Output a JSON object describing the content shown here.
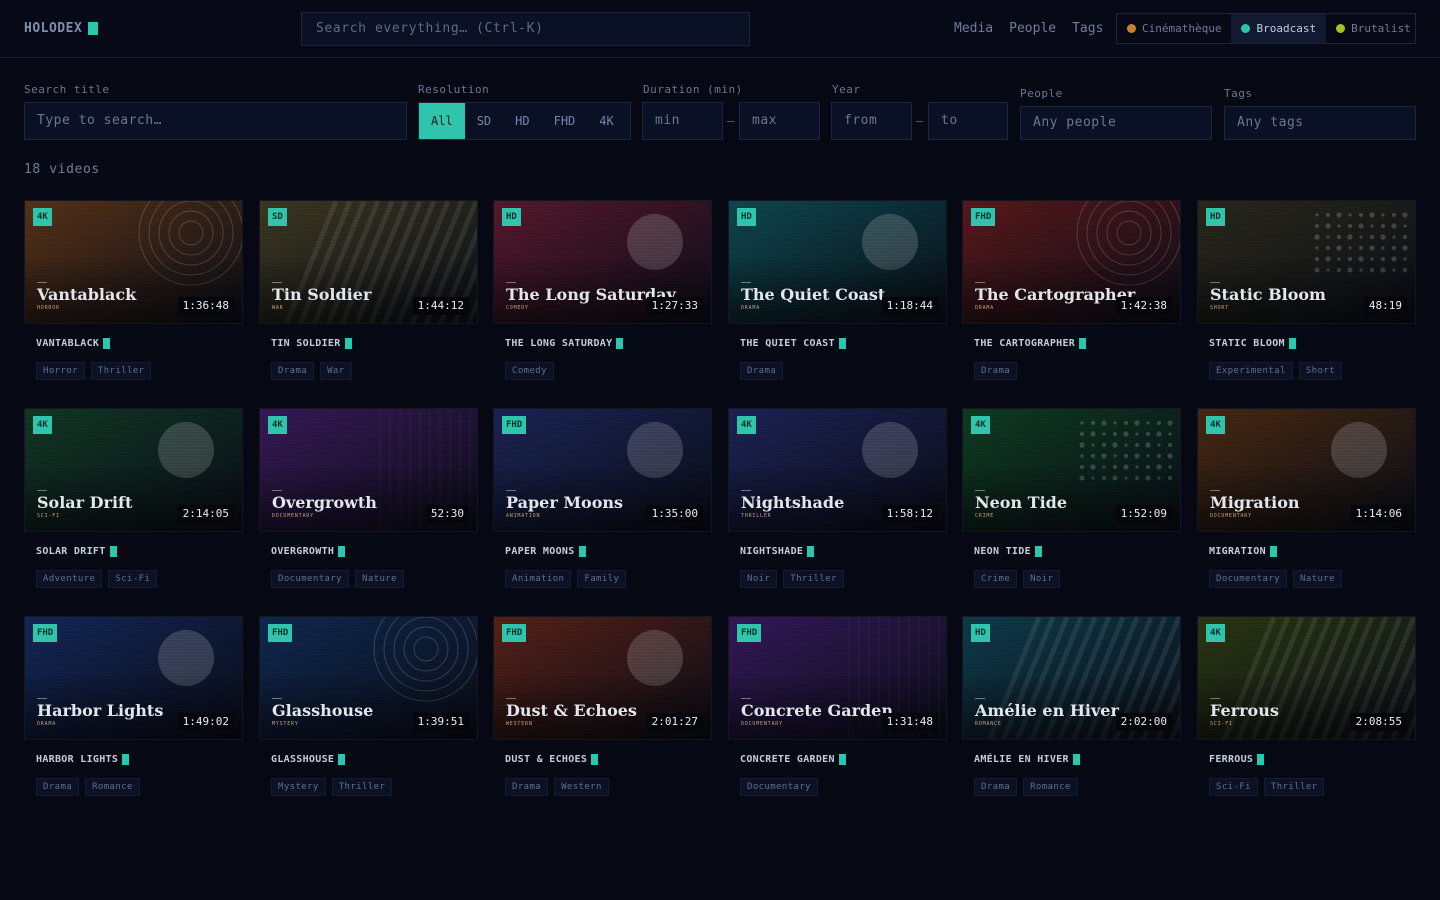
{
  "app": {
    "logo": "HOLODEX"
  },
  "search": {
    "placeholder": "Search everything…  (Ctrl-K)"
  },
  "nav": [
    "Media",
    "People",
    "Tags"
  ],
  "themes": [
    {
      "label": "Cinémathèque",
      "color": "#c9832a",
      "active": false
    },
    {
      "label": "Broadcast",
      "color": "#2fc5ad",
      "active": true
    },
    {
      "label": "Brutalist",
      "color": "#a2c22a",
      "active": false
    }
  ],
  "filters": {
    "title_label": "Search title",
    "title_placeholder": "Type to search…",
    "resolution_label": "Resolution",
    "resolutions": [
      "All",
      "SD",
      "HD",
      "FHD",
      "4K"
    ],
    "resolution_selected": "All",
    "duration_label": "Duration (min)",
    "duration_min": "min",
    "duration_max": "max",
    "year_label": "Year",
    "year_from": "from",
    "year_to": "to",
    "people_label": "People",
    "people_placeholder": "Any people",
    "tags_label": "Tags",
    "tags_placeholder": "Any tags",
    "range_sep": "–"
  },
  "results": {
    "count_text": "18 videos"
  },
  "videos": [
    {
      "title": "Vantablack",
      "upper": "VANTABLACK",
      "res": "4K",
      "duration": "1:36:48",
      "genre": "HORROR",
      "tags": [
        "Horror",
        "Thriller"
      ],
      "color": "#5a3418",
      "pattern": "rings"
    },
    {
      "title": "Tin Soldier",
      "upper": "TIN SOLDIER",
      "res": "SD",
      "duration": "1:44:12",
      "genre": "WAR",
      "tags": [
        "Drama",
        "War"
      ],
      "color": "#3e3a22",
      "pattern": "stripes"
    },
    {
      "title": "The Long Saturday",
      "upper": "THE LONG SATURDAY",
      "res": "HD",
      "duration": "1:27:33",
      "genre": "COMEDY",
      "tags": [
        "Comedy"
      ],
      "color": "#5a1a2e",
      "pattern": "circle"
    },
    {
      "title": "The Quiet Coast",
      "upper": "THE QUIET COAST",
      "res": "HD",
      "duration": "1:18:44",
      "genre": "DRAMA",
      "tags": [
        "Drama"
      ],
      "color": "#0f4a52",
      "pattern": "circle"
    },
    {
      "title": "The Cartographer",
      "upper": "THE CARTOGRAPHER",
      "res": "FHD",
      "duration": "1:42:38",
      "genre": "DRAMA",
      "tags": [
        "Drama"
      ],
      "color": "#5c1a1c",
      "pattern": "rings"
    },
    {
      "title": "Static Bloom",
      "upper": "STATIC BLOOM",
      "res": "HD",
      "duration": "48:19",
      "genre": "SHORT",
      "tags": [
        "Experimental",
        "Short"
      ],
      "color": "#2c2a1c",
      "pattern": "dots"
    },
    {
      "title": "Solar Drift",
      "upper": "SOLAR DRIFT",
      "res": "4K",
      "duration": "2:14:05",
      "genre": "SCI-FI",
      "tags": [
        "Adventure",
        "Sci-Fi"
      ],
      "color": "#123a26",
      "pattern": "circle"
    },
    {
      "title": "Overgrowth",
      "upper": "OVERGROWTH",
      "res": "4K",
      "duration": "52:30",
      "genre": "DOCUMENTARY",
      "tags": [
        "Documentary",
        "Nature"
      ],
      "color": "#3a1a5a",
      "pattern": "grid"
    },
    {
      "title": "Paper Moons",
      "upper": "PAPER MOONS",
      "res": "FHD",
      "duration": "1:35:00",
      "genre": "ANIMATION",
      "tags": [
        "Animation",
        "Family"
      ],
      "color": "#1c2658",
      "pattern": "circle"
    },
    {
      "title": "Nightshade",
      "upper": "NIGHTSHADE",
      "res": "4K",
      "duration": "1:58:12",
      "genre": "THRILLER",
      "tags": [
        "Noir",
        "Thriller"
      ],
      "color": "#1e2458",
      "pattern": "circle"
    },
    {
      "title": "Neon Tide",
      "upper": "NEON TIDE",
      "res": "4K",
      "duration": "1:52:09",
      "genre": "CRIME",
      "tags": [
        "Crime",
        "Noir"
      ],
      "color": "#0f3e22",
      "pattern": "dots"
    },
    {
      "title": "Migration",
      "upper": "MIGRATION",
      "res": "4K",
      "duration": "1:14:06",
      "genre": "DOCUMENTARY",
      "tags": [
        "Documentary",
        "Nature"
      ],
      "color": "#4a2a12",
      "pattern": "circle"
    },
    {
      "title": "Harbor Lights",
      "upper": "HARBOR LIGHTS",
      "res": "FHD",
      "duration": "1:49:02",
      "genre": "DRAMA",
      "tags": [
        "Drama",
        "Romance"
      ],
      "color": "#14285a",
      "pattern": "circle"
    },
    {
      "title": "Glasshouse",
      "upper": "GLASSHOUSE",
      "res": "FHD",
      "duration": "1:39:51",
      "genre": "MYSTERY",
      "tags": [
        "Mystery",
        "Thriller"
      ],
      "color": "#102a52",
      "pattern": "rings"
    },
    {
      "title": "Dust & Echoes",
      "upper": "DUST & ECHOES",
      "res": "FHD",
      "duration": "2:01:27",
      "genre": "WESTERN",
      "tags": [
        "Drama",
        "Western"
      ],
      "color": "#5a2218",
      "pattern": "circle"
    },
    {
      "title": "Concrete Garden",
      "upper": "CONCRETE GARDEN",
      "res": "FHD",
      "duration": "1:31:48",
      "genre": "DOCUMENTARY",
      "tags": [
        "Documentary"
      ],
      "color": "#361a5c",
      "pattern": "grid"
    },
    {
      "title": "Amélie en Hiver",
      "upper": "AMÉLIE EN HIVER",
      "res": "HD",
      "duration": "2:02:00",
      "genre": "ROMANCE",
      "tags": [
        "Drama",
        "Romance"
      ],
      "color": "#0f3e4e",
      "pattern": "stripes"
    },
    {
      "title": "Ferrous",
      "upper": "FERROUS",
      "res": "4K",
      "duration": "2:08:55",
      "genre": "SCI-FI",
      "tags": [
        "Sci-Fi",
        "Thriller"
      ],
      "color": "#2c3a12",
      "pattern": "stripes"
    }
  ]
}
